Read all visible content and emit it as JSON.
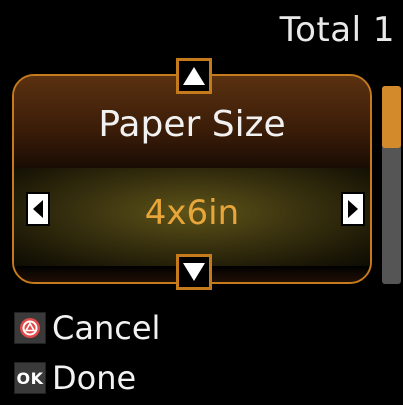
{
  "header": {
    "total_label": "Total 1"
  },
  "setting": {
    "title": "Paper Size",
    "value": "4x6in"
  },
  "actions": {
    "cancel_label": "Cancel",
    "ok_icon_text": "OK",
    "done_label": "Done"
  },
  "colors": {
    "accent_orange": "#c57a1c",
    "value_text": "#e8a53a",
    "cancel_icon": "#e34a4a",
    "scroll_thumb": "#d38a2a"
  }
}
